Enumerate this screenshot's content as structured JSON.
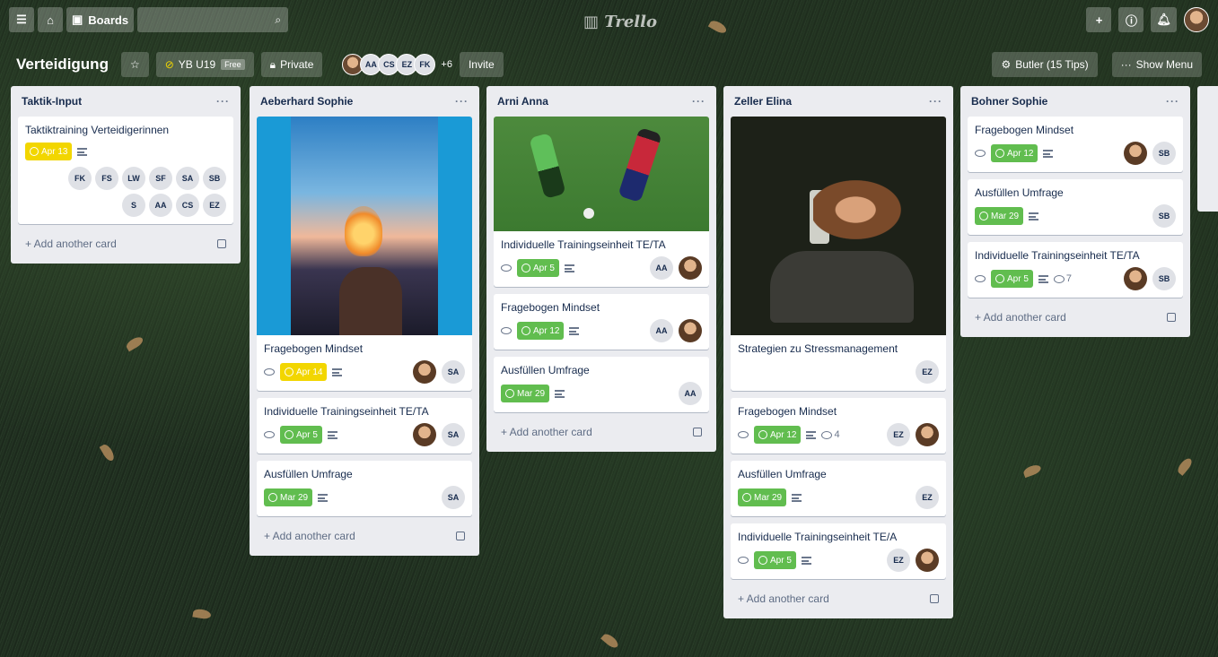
{
  "topbar": {
    "boards_label": "Boards",
    "logo": "Trello"
  },
  "board": {
    "title": "Verteidigung",
    "team": "YB U19",
    "team_badge": "Free",
    "visibility": "Private",
    "members": [
      "AA",
      "CS",
      "EZ",
      "FK"
    ],
    "members_more": "+6",
    "invite": "Invite",
    "butler": "Butler (15 Tips)",
    "show_menu": "Show Menu"
  },
  "colors": {
    "yellow": "#f2d600",
    "green": "#61bd4f"
  },
  "lists": [
    {
      "title": "Taktik-Input",
      "add_card": "+ Add another card",
      "cards": [
        {
          "title": "Taktiktraining Verteidigerinnen",
          "date": "Apr 13",
          "date_color": "yellow",
          "members": [
            "FK",
            "FS",
            "LW",
            "SF",
            "SA",
            "SB",
            "S",
            "AA",
            "CS",
            "EZ"
          ]
        }
      ]
    },
    {
      "title": "Aeberhard Sophie",
      "add_card": "+ Add another card",
      "cards": [
        {
          "title": "Fragebogen Mindset",
          "date": "Apr 14",
          "date_color": "yellow",
          "members": [
            "SA"
          ]
        },
        {
          "title": "Individuelle Trainingseinheit TE/TA",
          "date": "Apr 5",
          "date_color": "green",
          "members": [
            "SA"
          ]
        },
        {
          "title": "Ausfüllen Umfrage",
          "date": "Mar 29",
          "date_color": "green",
          "members": [
            "SA"
          ]
        }
      ]
    },
    {
      "title": "Arni Anna",
      "add_card": "+ Add another card",
      "cards": [
        {
          "title": "Individuelle Trainingseinheit TE/TA",
          "date": "Apr 5",
          "date_color": "green",
          "members": [
            "AA"
          ]
        },
        {
          "title": "Fragebogen Mindset",
          "date": "Apr 12",
          "date_color": "green",
          "members": [
            "AA"
          ]
        },
        {
          "title": "Ausfüllen Umfrage",
          "date": "Mar 29",
          "date_color": "green",
          "members": [
            "AA"
          ]
        }
      ]
    },
    {
      "title": "Zeller Elina",
      "add_card": "+ Add another card",
      "cards": [
        {
          "title": "Strategien zu Stressmanagement",
          "members": [
            "EZ"
          ]
        },
        {
          "title": "Fragebogen Mindset",
          "date": "Apr 12",
          "date_color": "green",
          "comments": "4",
          "members": [
            "EZ"
          ]
        },
        {
          "title": "Ausfüllen Umfrage",
          "date": "Mar 29",
          "date_color": "green",
          "members": [
            "EZ"
          ]
        },
        {
          "title": "Individuelle Trainingseinheit TE/A",
          "date": "Apr 5",
          "date_color": "green",
          "members": [
            "EZ"
          ]
        }
      ]
    },
    {
      "title": "Bohner Sophie",
      "add_card": "+ Add another card",
      "cards": [
        {
          "title": "Fragebogen Mindset",
          "date": "Apr 12",
          "date_color": "green",
          "members": [
            "SB"
          ]
        },
        {
          "title": "Ausfüllen Umfrage",
          "date": "Mar 29",
          "date_color": "green",
          "members": [
            "SB"
          ]
        },
        {
          "title": "Individuelle Trainingseinheit TE/TA",
          "date": "Apr 5",
          "date_color": "green",
          "comments": "7",
          "members": [
            "SB"
          ]
        }
      ]
    }
  ]
}
